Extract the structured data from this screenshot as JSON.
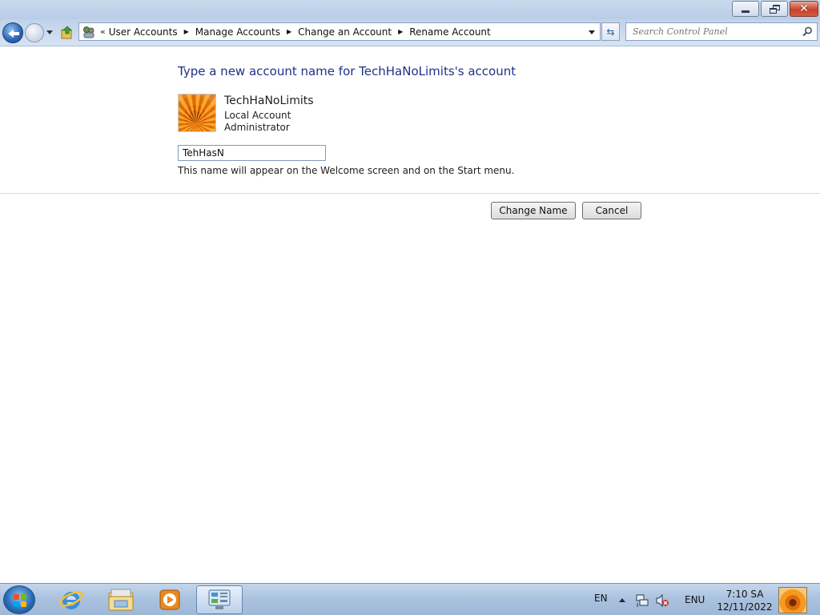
{
  "window": {
    "minimize_icon": "minimize-icon",
    "restore_icon": "restore-icon",
    "close_icon": "close-icon"
  },
  "nav": {
    "back_icon": "back-arrow-icon",
    "forward_icon": "forward-arrow-icon",
    "breadcrumb_overflow": "«",
    "breadcrumbs": [
      "User Accounts",
      "Manage Accounts",
      "Change an Account",
      "Rename Account"
    ],
    "search_placeholder": "Search Control Panel",
    "refresh_glyph": "⇆"
  },
  "main": {
    "heading": "Type a new account name for TechHaNoLimits's account",
    "user": {
      "name": "TechHaNoLimits",
      "type": "Local Account",
      "role": "Administrator"
    },
    "new_name_value": "TehHasN",
    "hint": "This name will appear on the Welcome screen and on the Start menu.",
    "change_name_button": "Change Name",
    "cancel_button": "Cancel"
  },
  "taskbar": {
    "language_short": "EN",
    "language_code": "ENU",
    "time": "7:10 SA",
    "date": "12/11/2022",
    "apps": [
      "internet-explorer-icon",
      "windows-explorer-icon",
      "media-player-icon",
      "control-panel-icon"
    ]
  },
  "colors": {
    "heading": "#1e3287",
    "taskbar": "#a9c1de",
    "close_button": "#c8432c"
  }
}
